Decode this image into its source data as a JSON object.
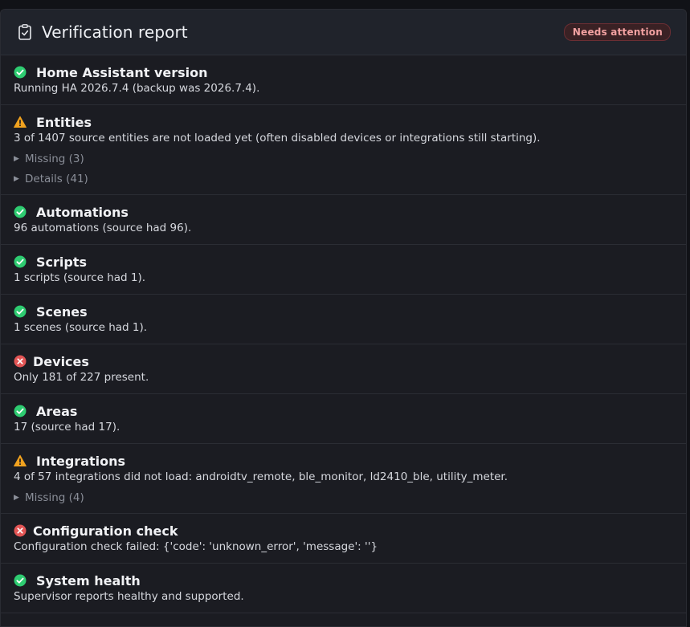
{
  "header": {
    "title": "Verification report",
    "badge": "Needs attention"
  },
  "colors": {
    "ok": "#2ecc71",
    "warn": "#f0a21f",
    "error": "#e25555",
    "badge_text": "#f2a1a1",
    "card_bg": "#1b1c22"
  },
  "sections": [
    {
      "status": "ok",
      "icon": "check-circle-icon",
      "title": "Home Assistant version",
      "description": "Running HA 2026.7.4 (backup was 2026.7.4)."
    },
    {
      "status": "warn",
      "icon": "warning-triangle-icon",
      "title": "Entities",
      "description": "3 of 1407 source entities are not loaded yet (often disabled devices or integrations still starting).",
      "toggles": [
        "Missing (3)",
        "Details (41)"
      ]
    },
    {
      "status": "ok",
      "icon": "check-circle-icon",
      "title": "Automations",
      "description": "96 automations (source had 96)."
    },
    {
      "status": "ok",
      "icon": "check-circle-icon",
      "title": "Scripts",
      "description": "1 scripts (source had 1)."
    },
    {
      "status": "ok",
      "icon": "check-circle-icon",
      "title": "Scenes",
      "description": "1 scenes (source had 1)."
    },
    {
      "status": "error",
      "icon": "x-circle-icon",
      "title": "Devices",
      "description": "Only 181 of 227 present."
    },
    {
      "status": "ok",
      "icon": "check-circle-icon",
      "title": "Areas",
      "description": "17 (source had 17)."
    },
    {
      "status": "warn",
      "icon": "warning-triangle-icon",
      "title": "Integrations",
      "description": "4 of 57 integrations did not load: androidtv_remote, ble_monitor, ld2410_ble, utility_meter.",
      "toggles": [
        "Missing (4)"
      ]
    },
    {
      "status": "error",
      "icon": "x-circle-icon",
      "title": "Configuration check",
      "description": "Configuration check failed: {'code': 'unknown_error', 'message': ''}"
    },
    {
      "status": "ok",
      "icon": "check-circle-icon",
      "title": "System health",
      "description": "Supervisor reports healthy and supported."
    }
  ]
}
